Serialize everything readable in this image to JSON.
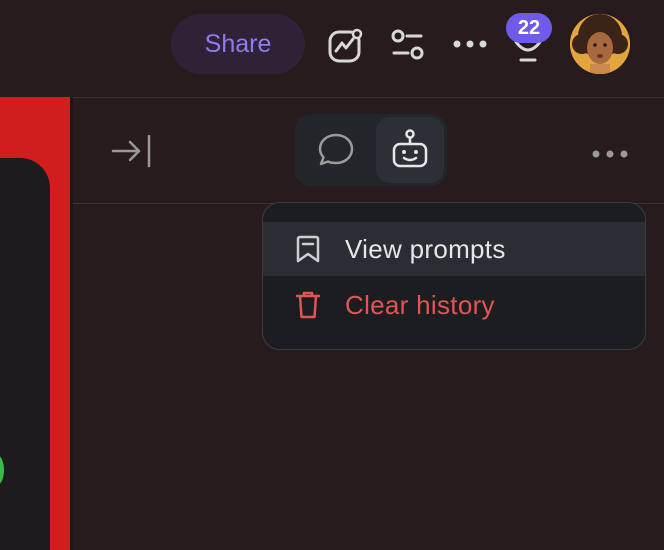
{
  "topbar": {
    "share_label": "Share",
    "notification_count": "22"
  },
  "panel": {
    "tabs": [
      {
        "name": "chat",
        "icon": "chat-bubble-icon",
        "active": false
      },
      {
        "name": "assistant",
        "icon": "robot-icon",
        "active": true
      }
    ]
  },
  "menu": {
    "items": [
      {
        "label": "View prompts",
        "icon": "bookmark-icon",
        "color": "#e6e6e6"
      },
      {
        "label": "Clear history",
        "icon": "trash-icon",
        "color": "#e25555"
      }
    ]
  },
  "colors": {
    "accent": "#6d5ce8",
    "danger": "#e25555",
    "left_panel": "#d11d1d"
  }
}
